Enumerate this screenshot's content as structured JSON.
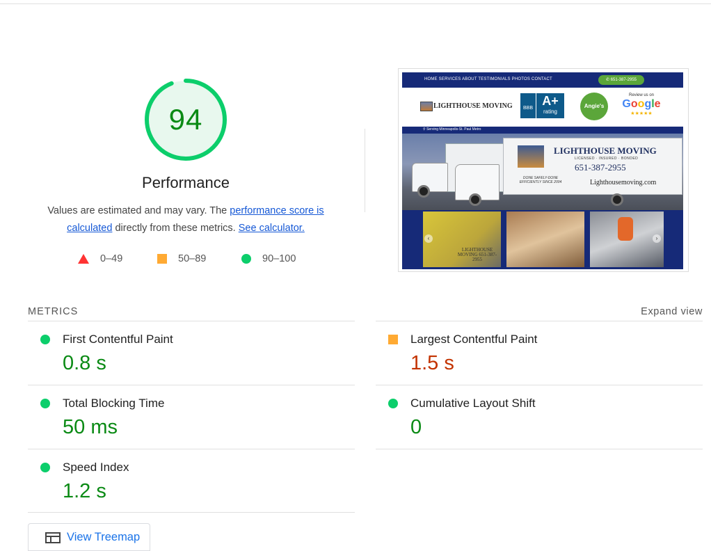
{
  "score": {
    "value": "94",
    "title": "Performance",
    "color": "#0cce6b"
  },
  "description": {
    "text1": "Values are estimated and may vary. The ",
    "link1": "performance score is calculated",
    "text2": " directly from these metrics. ",
    "link2": "See calculator."
  },
  "legend": [
    {
      "shape": "triangle",
      "range": "0–49",
      "color": "#ff3333"
    },
    {
      "shape": "square",
      "range": "50–89",
      "color": "#ffaa33"
    },
    {
      "shape": "circle",
      "range": "90–100",
      "color": "#0cce6b"
    }
  ],
  "thumbnail": {
    "nav_links": "HOME  SERVICES  ABOUT  TESTIMONIALS  PHOTOS  CONTACT",
    "nav_phone": "651-387-2955",
    "logo_text": "LIGHTHOUSE MOVING",
    "bbb_text": "BBB",
    "aplus_big": "A+",
    "aplus_small": "rating",
    "angies_text": "Angie's list",
    "google_review": "Review us on",
    "google_stars": "★★★★★",
    "strip_text": "Serving Minneapolis-St. Paul Metro",
    "truck_title": "LIGHTHOUSE  MOVING",
    "truck_sub": "LICENSED · INSURED · BONDED",
    "truck_phone": "651-387-2955",
    "truck_slogan": "DONE SAFELY-DONE EFFICIENTLY SINCE 2004",
    "truck_web": "Lighthousemoving.com",
    "gallery_text": "LIGHTHOUSE MOVING 651-387-2955"
  },
  "metrics": {
    "label": "METRICS",
    "expand": "Expand view",
    "items": [
      {
        "name": "First Contentful Paint",
        "value": "0.8 s",
        "rating": "good"
      },
      {
        "name": "Largest Contentful Paint",
        "value": "1.5 s",
        "rating": "average"
      },
      {
        "name": "Total Blocking Time",
        "value": "50 ms",
        "rating": "good"
      },
      {
        "name": "Cumulative Layout Shift",
        "value": "0",
        "rating": "good"
      },
      {
        "name": "Speed Index",
        "value": "1.2 s",
        "rating": "good"
      }
    ]
  },
  "treemap_button": {
    "label": "View Treemap"
  }
}
